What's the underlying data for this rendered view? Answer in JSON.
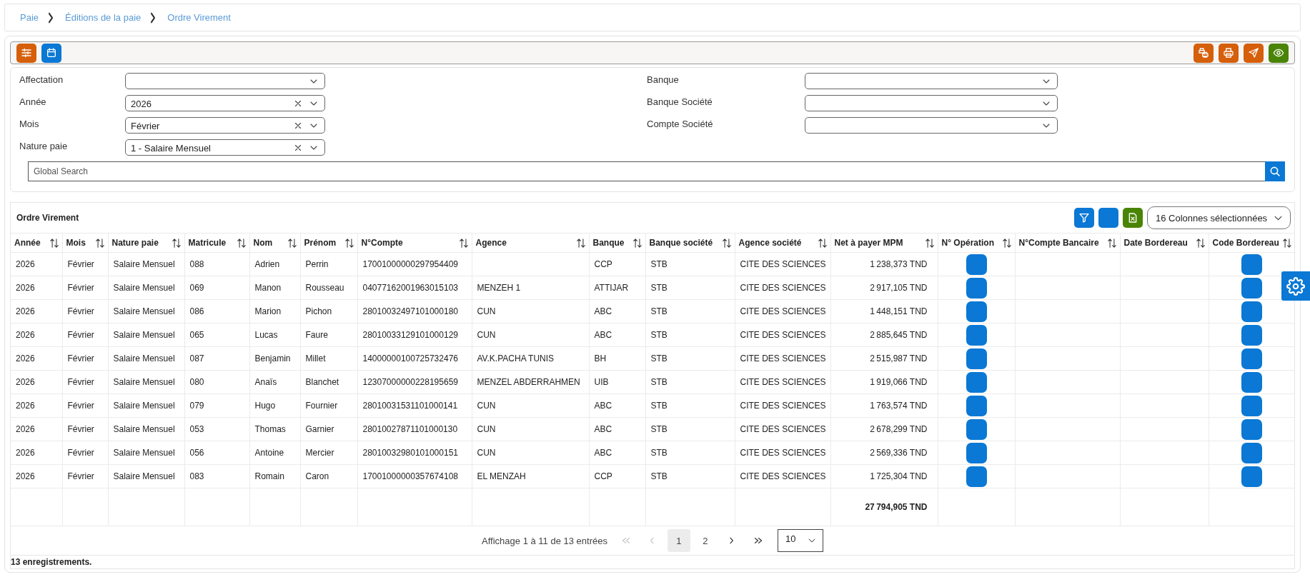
{
  "breadcrumb": [
    "Paie",
    "Éditions de la paie",
    "Ordre Virement"
  ],
  "toolbar": {
    "left": [
      {
        "kind": "settings"
      },
      {
        "kind": "calendar"
      }
    ],
    "right": [
      {
        "kind": "copies"
      },
      {
        "kind": "print"
      },
      {
        "kind": "send"
      },
      {
        "kind": "preview"
      }
    ]
  },
  "filters": {
    "left": [
      {
        "label": "Affectation"
      },
      {
        "label": "Année",
        "value": "2026"
      },
      {
        "label": "Mois",
        "value": "Février"
      },
      {
        "label": "Nature paie",
        "value": "1 - Salaire Mensuel"
      }
    ],
    "right": [
      {
        "label": "Banque"
      },
      {
        "label": "Banque Société"
      },
      {
        "label": "Compte Société"
      }
    ]
  },
  "search": {
    "placeholder": "Global Search"
  },
  "table": {
    "title": "Ordre Virement",
    "tools": [
      {
        "kind": "filter"
      },
      {
        "kind": "blank"
      },
      {
        "kind": "excel"
      }
    ],
    "column_picker": "16 Colonnes sélectionnées",
    "columns": [
      {
        "label": "Année",
        "kind": "text"
      },
      {
        "label": "Mois",
        "kind": "text"
      },
      {
        "label": "Nature paie",
        "kind": "text"
      },
      {
        "label": "Matricule",
        "kind": "text"
      },
      {
        "label": "Nom",
        "kind": "text"
      },
      {
        "label": "Prénom",
        "kind": "text"
      },
      {
        "label": "N°Compte",
        "kind": "text"
      },
      {
        "label": "Agence",
        "kind": "text"
      },
      {
        "label": "Banque",
        "kind": "text"
      },
      {
        "label": "Banque société",
        "kind": "text"
      },
      {
        "label": "Agence société",
        "kind": "text"
      },
      {
        "label": "Net à payer MPM",
        "kind": "amount"
      },
      {
        "label": "N° Opération",
        "kind": "button"
      },
      {
        "label": "N°Compte Bancaire",
        "kind": "text"
      },
      {
        "label": "Date Bordereau",
        "kind": "text"
      },
      {
        "label": "Code Bordereau",
        "kind": "button"
      }
    ],
    "rows": [
      {
        "annee": "2026",
        "mois": "Février",
        "nature": "Salaire Mensuel",
        "matricule": "088",
        "nom": "Adrien",
        "prenom": "Perrin",
        "compte": "17001000000297954409",
        "banque": "CCP",
        "banque_societe": "STB",
        "agence_societe": "CITE DES SCIENCES",
        "net": "1 238,373 TND"
      },
      {
        "annee": "2026",
        "mois": "Février",
        "nature": "Salaire Mensuel",
        "matricule": "069",
        "nom": "Manon",
        "prenom": "Rousseau",
        "compte": "04077162001963015103",
        "agence": "MENZEH 1",
        "banque": "ATTIJAR",
        "banque_societe": "STB",
        "agence_societe": "CITE DES SCIENCES",
        "net": "2 917,105 TND"
      },
      {
        "annee": "2026",
        "mois": "Février",
        "nature": "Salaire Mensuel",
        "matricule": "086",
        "nom": "Marion",
        "prenom": "Pichon",
        "compte": "28010032497101000180",
        "agence": "CUN",
        "banque": "ABC",
        "banque_societe": "STB",
        "agence_societe": "CITE DES SCIENCES",
        "net": "1 448,151 TND"
      },
      {
        "annee": "2026",
        "mois": "Février",
        "nature": "Salaire Mensuel",
        "matricule": "065",
        "nom": "Lucas",
        "prenom": "Faure",
        "compte": "28010033129101000129",
        "agence": "CUN",
        "banque": "ABC",
        "banque_societe": "STB",
        "agence_societe": "CITE DES SCIENCES",
        "net": "2 885,645 TND"
      },
      {
        "annee": "2026",
        "mois": "Février",
        "nature": "Salaire Mensuel",
        "matricule": "087",
        "nom": "Benjamin",
        "prenom": "Millet",
        "compte": "14000000100725732476",
        "agence": "AV.K.PACHA TUNIS",
        "banque": "BH",
        "banque_societe": "STB",
        "agence_societe": "CITE DES SCIENCES",
        "net": "2 515,987 TND"
      },
      {
        "annee": "2026",
        "mois": "Février",
        "nature": "Salaire Mensuel",
        "matricule": "080",
        "nom": "Anaïs",
        "prenom": "Blanchet",
        "compte": "12307000000228195659",
        "agence": "MENZEL ABDERRAHMEN",
        "banque": "UIB",
        "banque_societe": "STB",
        "agence_societe": "CITE DES SCIENCES",
        "net": "1 919,066 TND"
      },
      {
        "annee": "2026",
        "mois": "Février",
        "nature": "Salaire Mensuel",
        "matricule": "079",
        "nom": "Hugo",
        "prenom": "Fournier",
        "compte": "28010031531101000141",
        "agence": "CUN",
        "banque": "ABC",
        "banque_societe": "STB",
        "agence_societe": "CITE DES SCIENCES",
        "net": "1 763,574 TND"
      },
      {
        "annee": "2026",
        "mois": "Février",
        "nature": "Salaire Mensuel",
        "matricule": "053",
        "nom": "Thomas",
        "prenom": "Garnier",
        "compte": "28010027871101000130",
        "agence": "CUN",
        "banque": "ABC",
        "banque_societe": "STB",
        "agence_societe": "CITE DES SCIENCES",
        "net": "2 678,299 TND"
      },
      {
        "annee": "2026",
        "mois": "Février",
        "nature": "Salaire Mensuel",
        "matricule": "056",
        "nom": "Antoine",
        "prenom": "Mercier",
        "compte": "28010032980101000151",
        "agence": "CUN",
        "banque": "ABC",
        "banque_societe": "STB",
        "agence_societe": "CITE DES SCIENCES",
        "net": "2 569,336 TND"
      },
      {
        "annee": "2026",
        "mois": "Février",
        "nature": "Salaire Mensuel",
        "matricule": "083",
        "nom": "Romain",
        "prenom": "Caron",
        "compte": "17001000000357674108",
        "agence": "EL MENZAH",
        "banque": "CCP",
        "banque_societe": "STB",
        "agence_societe": "CITE DES SCIENCES",
        "net": "1 725,304 TND"
      }
    ],
    "total": "27 794,905 TND"
  },
  "pagination": {
    "summary": "Affichage 1 à 11 de 13 entrées",
    "nav": [
      {
        "kind": "first",
        "disabled": true
      },
      {
        "kind": "prev",
        "disabled": true
      },
      {
        "kind": "next",
        "disabled": false
      },
      {
        "kind": "last",
        "disabled": false
      }
    ],
    "pages": [
      {
        "label": "1",
        "selected": true
      },
      {
        "label": "2",
        "selected": false
      }
    ],
    "page_size": "10"
  },
  "record_count": "13 enregistrements."
}
